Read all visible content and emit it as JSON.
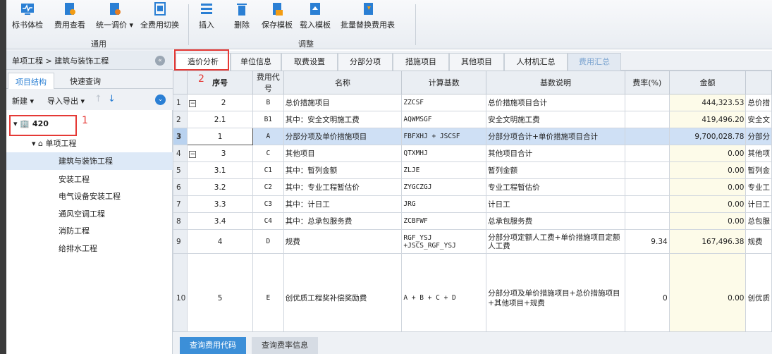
{
  "toolbar": {
    "groups": [
      {
        "label": "通用",
        "buttons": [
          "标书体检",
          "费用查看",
          "统一调价",
          "全费用切换"
        ]
      },
      {
        "label": "调整",
        "buttons": [
          "插入",
          "删除",
          "保存模板",
          "载入模板",
          "批量替换费用表"
        ]
      }
    ]
  },
  "breadcrumb": "单项工程 > 建筑与装饰工程",
  "left_tabs": [
    "项目结构",
    "快速查询"
  ],
  "left_tools": {
    "new": "新建",
    "import_export": "导入导出"
  },
  "tree": {
    "root": "420",
    "child": "单项工程",
    "items": [
      "建筑与装饰工程",
      "安装工程",
      "电气设备安装工程",
      "通风空调工程",
      "消防工程",
      "给排水工程"
    ]
  },
  "annotations": {
    "one": "1",
    "two": "2"
  },
  "main_tabs": [
    "造价分析",
    "单位信息",
    "取费设置",
    "分部分项",
    "措施项目",
    "其他项目",
    "人材机汇总",
    "费用汇总"
  ],
  "columns": [
    "序号",
    "费用代号",
    "名称",
    "计算基数",
    "基数说明",
    "费率(%)",
    "金额"
  ],
  "rows": [
    {
      "rn": "1",
      "expand": "−",
      "seq": "2",
      "code": "B",
      "name": "总价措施项目",
      "base": "ZZCSF",
      "desc": "总价措施项目合计",
      "rate": "",
      "amount": "444,323.53",
      "extra": "总价措"
    },
    {
      "rn": "2",
      "expand": "",
      "seq": "2.1",
      "code": "B1",
      "name": "其中：安全文明施工费",
      "base": "AQWMSGF",
      "desc": "安全文明施工费",
      "rate": "",
      "amount": "419,496.20",
      "extra": "安全文"
    },
    {
      "rn": "3",
      "expand": "",
      "seq": "1",
      "code": "A",
      "name": "分部分项及单价措施项目",
      "base": "FBFXHJ + JSCSF",
      "desc": "分部分项合计+单价措施项目合计",
      "rate": "",
      "amount": "9,700,028.78",
      "extra": "分部分"
    },
    {
      "rn": "4",
      "expand": "−",
      "seq": "3",
      "code": "C",
      "name": "其他项目",
      "base": "QTXMHJ",
      "desc": "其他项目合计",
      "rate": "",
      "amount": "0.00",
      "extra": "其他项"
    },
    {
      "rn": "5",
      "expand": "",
      "seq": "3.1",
      "code": "C1",
      "name": "其中：暂列金额",
      "base": "ZLJE",
      "desc": "暂列金额",
      "rate": "",
      "amount": "0.00",
      "extra": "暂列金"
    },
    {
      "rn": "6",
      "expand": "",
      "seq": "3.2",
      "code": "C2",
      "name": "其中：专业工程暂估价",
      "base": "ZYGCZGJ",
      "desc": "专业工程暂估价",
      "rate": "",
      "amount": "0.00",
      "extra": "专业工"
    },
    {
      "rn": "7",
      "expand": "",
      "seq": "3.3",
      "code": "C3",
      "name": "其中：计日工",
      "base": "JRG",
      "desc": "计日工",
      "rate": "",
      "amount": "0.00",
      "extra": "计日工"
    },
    {
      "rn": "8",
      "expand": "",
      "seq": "3.4",
      "code": "C4",
      "name": "其中：总承包服务费",
      "base": "ZCBFWF",
      "desc": "总承包服务费",
      "rate": "",
      "amount": "0.00",
      "extra": "总包服"
    },
    {
      "rn": "9",
      "expand": "",
      "seq": "4",
      "code": "D",
      "name": "规费",
      "base": "RGF_YSJ +JSCS_RGF_YSJ",
      "desc": "分部分项定额人工费+单价措施项目定额人工费",
      "rate": "9.34",
      "amount": "167,496.38",
      "extra": "规费"
    },
    {
      "rn": "10",
      "expand": "",
      "seq": "5",
      "code": "E",
      "name": "创优质工程奖补偿奖励费",
      "base": "A + B + C + D",
      "desc": "分部分项及单价措施项目+总价措施项目+其他项目+规费",
      "rate": "0",
      "amount": "0.00",
      "extra": "创优质"
    }
  ],
  "bottom_tabs": [
    "查询费用代码",
    "查询费率信息"
  ],
  "colors": {
    "accent": "#2a7fd4",
    "annotation": "#e53935",
    "selected_row": "#cfe0f5"
  }
}
